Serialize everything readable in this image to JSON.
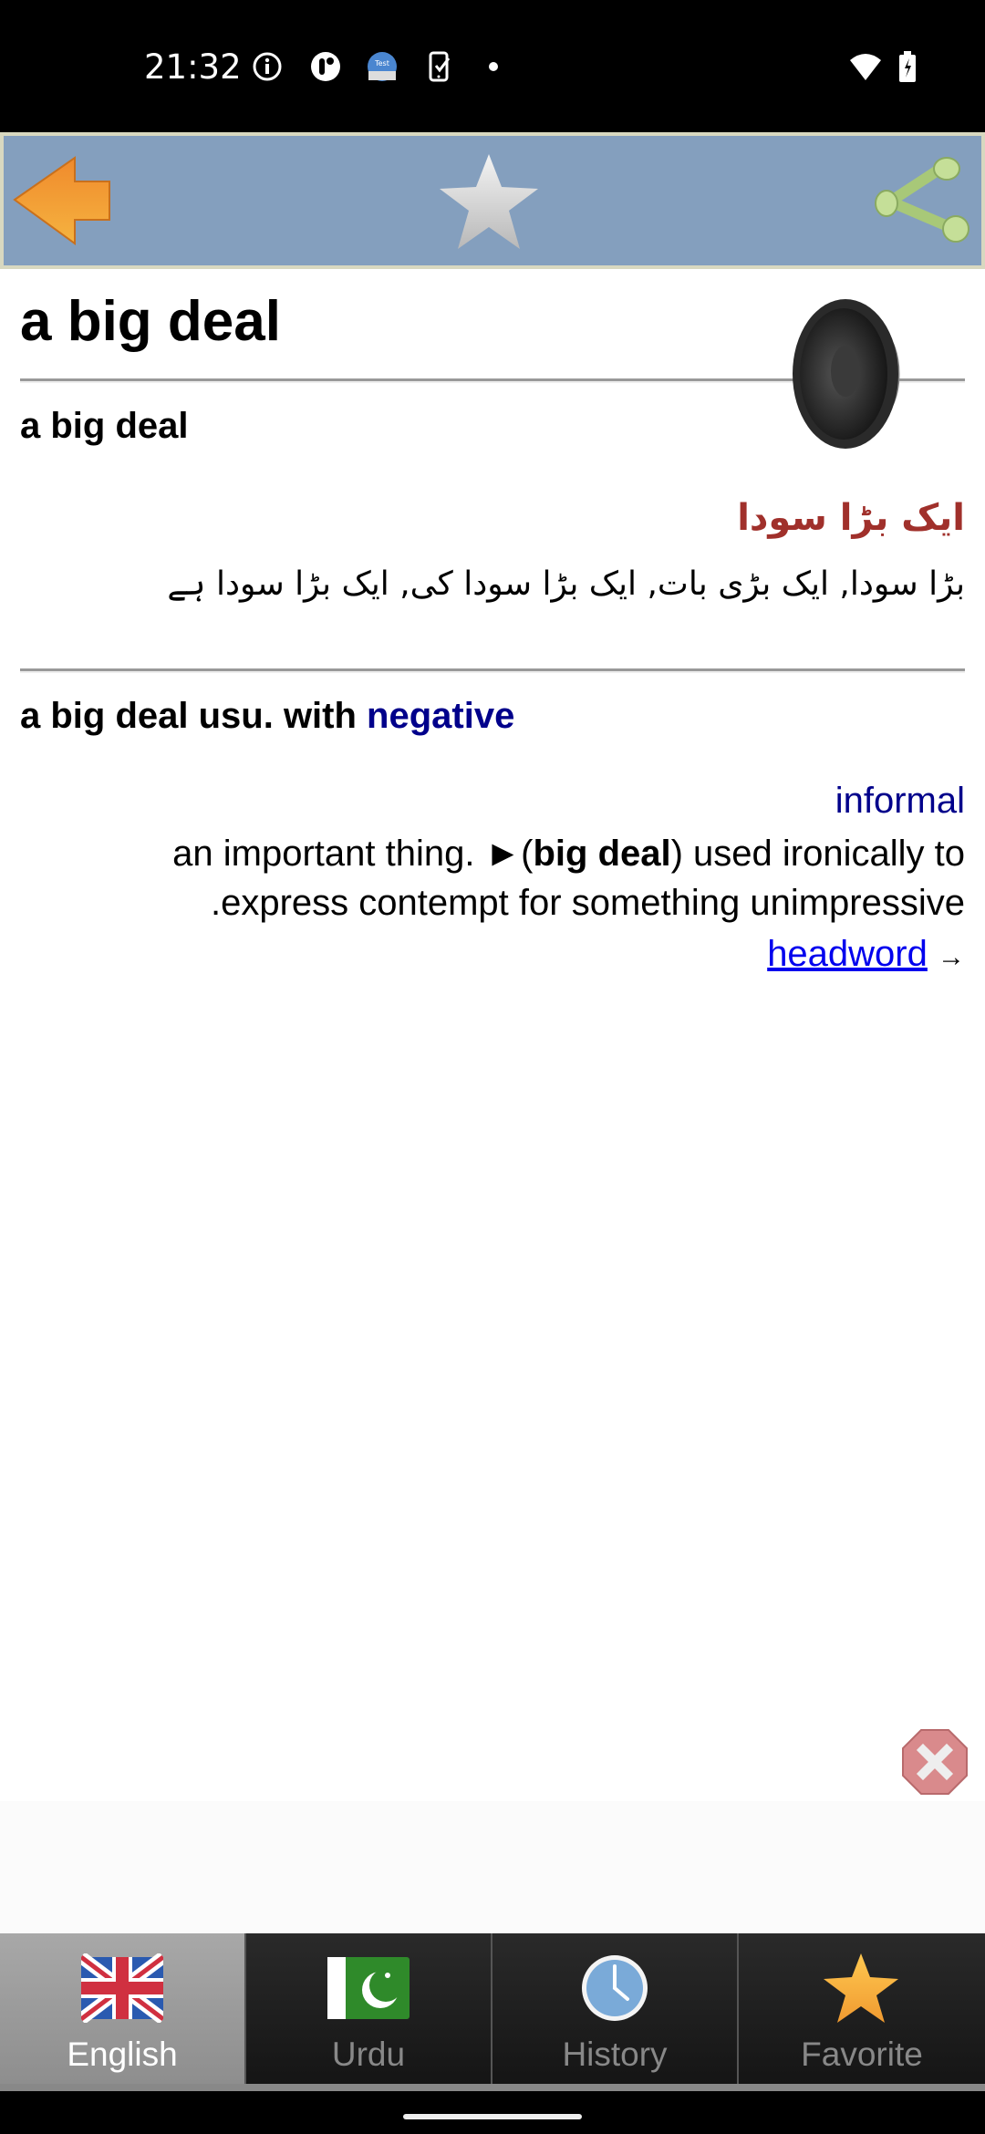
{
  "status_bar": {
    "time": "21:32",
    "icons": [
      "info-icon",
      "app-icon",
      "test-app-icon",
      "phone-check-icon",
      "dot-icon",
      "wifi-icon",
      "battery-charging-icon"
    ]
  },
  "toolbar": {
    "back_icon": "back-arrow-icon",
    "favorite_icon": "star-icon",
    "share_icon": "share-icon"
  },
  "entry": {
    "headword": "a big deal",
    "sections": [
      {
        "phrase": "a big deal",
        "urdu_title": "ایک بڑا سودا",
        "urdu_meanings": "بڑا سودا, ایک بڑی بات, ایک بڑا سودا کی, ایک بڑا سودا ہے"
      },
      {
        "phrase_prefix": "a big deal usu. with ",
        "phrase_highlight": "negative",
        "register": "informal",
        "definition_part1": "an important thing. ►(",
        "definition_bold": "big deal",
        "definition_part2": ") used ironically to",
        "definition_line2": ".express contempt for something unimpressive",
        "link_label": "headword",
        "link_arrow": "→"
      }
    ]
  },
  "tabs": [
    {
      "label": "English",
      "icon": "uk-flag-icon",
      "active": true
    },
    {
      "label": "Urdu",
      "icon": "pakistan-flag-icon",
      "active": false
    },
    {
      "label": "History",
      "icon": "clock-icon",
      "active": false
    },
    {
      "label": "Favorite",
      "icon": "star-icon",
      "active": false
    }
  ],
  "colors": {
    "toolbar_bg": "#849fbe",
    "urdu_title": "#a0302b",
    "highlight_blue": "#00008b",
    "link_blue": "#0000ee"
  }
}
